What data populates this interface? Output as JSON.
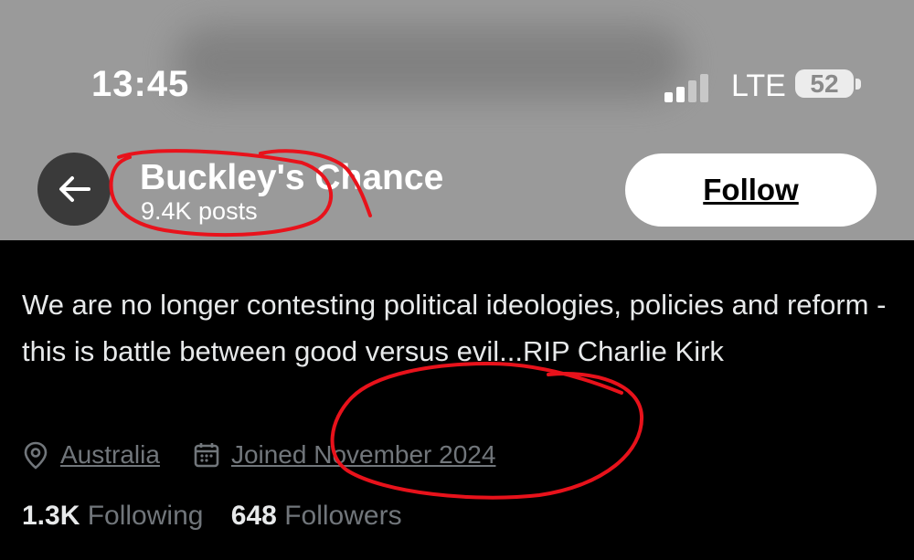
{
  "status_bar": {
    "time": "13:45",
    "network": "LTE",
    "battery": "52"
  },
  "profile": {
    "name": "Buckley's Chance",
    "post_count": "9.4K posts",
    "follow_label": "Follow",
    "bio": "We are no longer contesting political ideologies, policies and reform - this is battle between good versus evil...RIP Charlie Kirk",
    "location": "Australia",
    "joined": "Joined November 2024",
    "following_count": "1.3K",
    "following_label": "Following",
    "followers_count": "648",
    "followers_label": "Followers"
  },
  "icons": {
    "back": "arrow-left-icon",
    "location": "location-pin-icon",
    "calendar": "calendar-icon",
    "signal": "signal-icon"
  },
  "colors": {
    "background": "#000000",
    "header": "#9a9a9a",
    "primary_text": "#e7e9ea",
    "secondary_text": "#71767b",
    "annotation": "#e8121b"
  }
}
